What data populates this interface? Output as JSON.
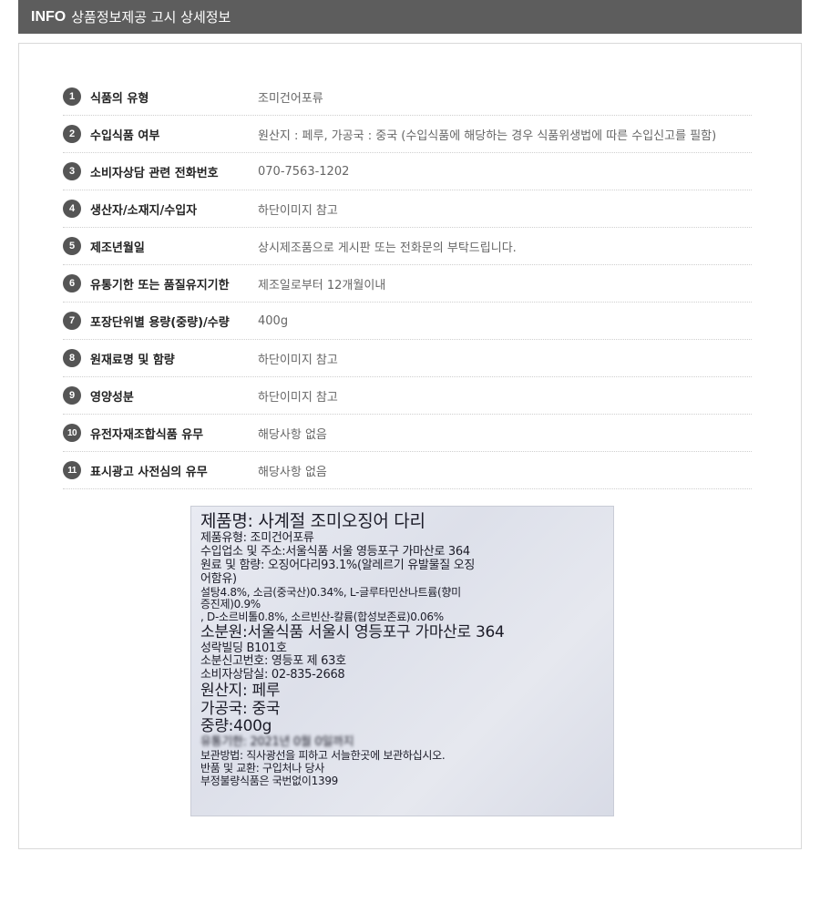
{
  "header": {
    "title_strong": "INFO",
    "title": "상품정보제공 고시 상세정보"
  },
  "items": [
    {
      "num": "1",
      "label": "식품의 유형",
      "value": "조미건어포류"
    },
    {
      "num": "2",
      "label": "수입식품 여부",
      "value": "원산지 : 페루, 가공국 : 중국 (수입식품에 해당하는 경우 식품위생법에 따른 수입신고를 필함)"
    },
    {
      "num": "3",
      "label": "소비자상담 관련 전화번호",
      "value": "070-7563-1202"
    },
    {
      "num": "4",
      "label": "생산자/소재지/수입자",
      "value": "하단이미지 참고"
    },
    {
      "num": "5",
      "label": "제조년월일",
      "value": "상시제조품으로 게시판 또는 전화문의 부탁드립니다."
    },
    {
      "num": "6",
      "label": "유통기한 또는 품질유지기한",
      "value": "제조일로부터 12개월이내"
    },
    {
      "num": "7",
      "label": "포장단위별 용량(중량)/수량",
      "value": "400g"
    },
    {
      "num": "8",
      "label": "원재료명 및 함량",
      "value": "하단이미지 참고"
    },
    {
      "num": "9",
      "label": "영양성분",
      "value": "하단이미지 참고"
    },
    {
      "num": "10",
      "label": "유전자재조합식품 유무",
      "value": "해당사항 없음"
    },
    {
      "num": "11",
      "label": "표시광고 사전심의 유무",
      "value": "해당사항 없음"
    }
  ],
  "label_photo": {
    "lines": [
      "제품명: 사계절 조미오징어 다리",
      "제품유형: 조미건어포류",
      "수입업소 및 주소:서울식품 서울 영등포구 가마산로 364",
      "원료 및 함량: 오징어다리93.1%(알레르기 유발물질 오징",
      "어함유)",
      "설탕4.8%, 소금(중국산)0.34%, L-글루타민산나트륨(향미",
      "증진제)0.9%",
      ", D-소르비톨0.8%, 소르빈산-칼륨(합성보존료)0.06%",
      "소분원:서울식품 서울시 영등포구 가마산로 364",
      "성락빌딩 B101호",
      "소분신고번호: 영등포 제 63호",
      "소비자상담실: 02-835-2668",
      "원산지: 페루",
      "가공국: 중국",
      "중량:400g",
      "유통기한: 2021년 0월 0일까지",
      "보관방법: 직사광선을 피하고 서늘한곳에 보관하십시오.",
      "반품 및 교환: 구입처나 당사",
      "부정불량식품은 국번없이1399"
    ]
  }
}
